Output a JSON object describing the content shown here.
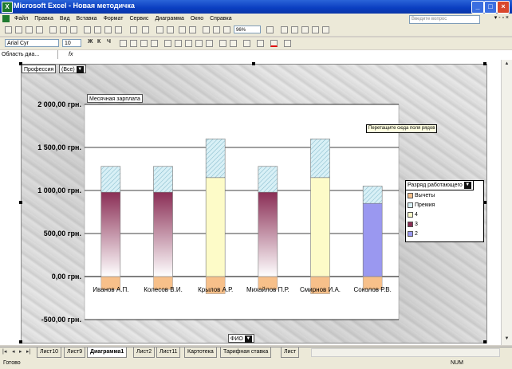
{
  "window": {
    "title": "Microsoft Excel - Новая методичка",
    "app_icon": "excel-icon",
    "buttons": [
      "minimize-icon",
      "maximize-icon",
      "close-icon"
    ]
  },
  "menu": {
    "items": [
      "Файл",
      "Правка",
      "Вид",
      "Вставка",
      "Формат",
      "Сервис",
      "Диаграмма",
      "Окно",
      "Справка"
    ],
    "help_placeholder": "Введите вопрос"
  },
  "toolbar": {
    "font_name": "Arial Cyr",
    "font_size": "10",
    "zoom": "96%",
    "bold_label": "Ж",
    "italic_label": "К",
    "underline_label": "Ч"
  },
  "formula_bar": {
    "name_box": "Область диа...",
    "fx_label": "fx"
  },
  "pivot": {
    "page_field": "Профессия",
    "page_value": "(Все)",
    "data_field": "Месячная зарплата",
    "category_field": "ФИО",
    "series_field": "Разряд работающего",
    "drop_hint": "Перетащите сюда поля рядов"
  },
  "chart_data": {
    "type": "bar",
    "stacked": true,
    "categories": [
      "Иванов А.П.",
      "Колесов В.И.",
      "Крылов А.Р.",
      "Михайлов П.Р.",
      "Смирнов И.А.",
      "Соколов Р.В."
    ],
    "series": [
      {
        "name": "Вычеты",
        "values": [
          -150,
          -150,
          -200,
          -150,
          -200,
          -150
        ],
        "color": "#f7c08a"
      },
      {
        "name": "Премия",
        "values": [
          300,
          300,
          450,
          300,
          450,
          200
        ],
        "color": "#c7e8ef"
      },
      {
        "name": "4",
        "values": [
          0,
          0,
          1150,
          0,
          1150,
          0
        ],
        "color": "#fdfbc8"
      },
      {
        "name": "3",
        "values": [
          980,
          980,
          0,
          980,
          0,
          0
        ],
        "color": "#8a2e55"
      },
      {
        "name": "2",
        "values": [
          0,
          0,
          0,
          0,
          0,
          850
        ],
        "color": "#9a98f0"
      }
    ],
    "y_ticks": [
      "2 000,00 грн.",
      "1 500,00 грн.",
      "1 000,00 грн.",
      "500,00 грн.",
      "0,00 грн.",
      "-500,00 грн."
    ],
    "ylim": [
      -500,
      2000
    ],
    "grid": true,
    "legend_position": "right"
  },
  "sheets": {
    "tabs": [
      "Лист10",
      "Лист9",
      "Диаграмма1",
      "Лист2",
      "Лист11",
      "Картотека",
      "Тарифная ставка",
      "Лист"
    ],
    "active": "Диаграмма1"
  },
  "status": {
    "ready": "Готово",
    "num": "NUM"
  }
}
